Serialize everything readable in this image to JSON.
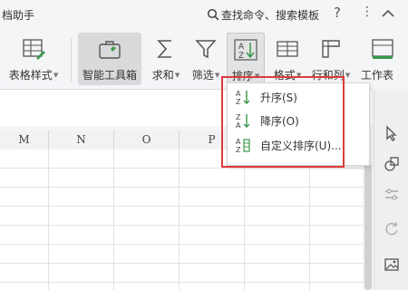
{
  "window": {
    "title_fragment": "档助手"
  },
  "search": {
    "label": "查找命令、搜索模板"
  },
  "window_controls": [
    "help-icon",
    "more-icon",
    "collapse-icon"
  ],
  "ribbon": {
    "buttons": [
      {
        "label": "表格样式",
        "icon": "table-style-icon",
        "has_dropdown": true
      },
      {
        "label": "智能工具箱",
        "icon": "smart-toolbox-icon",
        "has_dropdown": false
      },
      {
        "label": "求和",
        "icon": "sum-icon",
        "has_dropdown": true
      },
      {
        "label": "筛选",
        "icon": "filter-icon",
        "has_dropdown": true
      },
      {
        "label": "排序",
        "icon": "sort-icon",
        "has_dropdown": true
      },
      {
        "label": "格式",
        "icon": "format-icon",
        "has_dropdown": true
      },
      {
        "label": "行和列",
        "icon": "rows-columns-icon",
        "has_dropdown": true
      },
      {
        "label": "工作表",
        "icon": "worksheet-icon",
        "has_dropdown": false
      }
    ]
  },
  "sort_menu": {
    "items": [
      {
        "label": "升序(S)",
        "icon": "sort-ascending-icon"
      },
      {
        "label": "降序(O)",
        "icon": "sort-descending-icon"
      },
      {
        "label": "自定义排序(U)...",
        "icon": "custom-sort-icon"
      }
    ]
  },
  "columns": [
    "M",
    "N",
    "O",
    "P"
  ],
  "colors": {
    "highlight_border": "#e03b3b",
    "icon_green": "#3a9a4a",
    "icon_gray": "#555555"
  }
}
